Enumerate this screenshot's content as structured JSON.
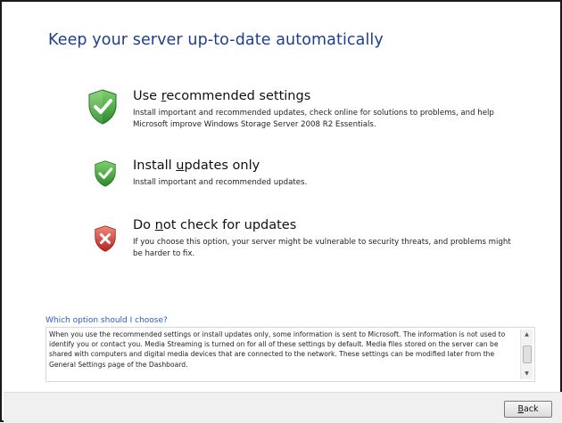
{
  "page": {
    "title": "Keep your server up-to-date automatically"
  },
  "options": [
    {
      "title_pre": "Use ",
      "title_acc": "r",
      "title_post": "ecommended settings",
      "description": "Install important and recommended updates, check online for solutions to problems, and help Microsoft improve Windows Storage Server 2008 R2 Essentials.",
      "icon": "shield-check-icon"
    },
    {
      "title_pre": "Install ",
      "title_acc": "u",
      "title_post": "pdates only",
      "description": "Install important and recommended updates.",
      "icon": "shield-check-icon"
    },
    {
      "title_pre": "Do ",
      "title_acc": "n",
      "title_post": "ot check for updates",
      "description": "If you choose this option, your server might be vulnerable to security threats, and problems might be harder to fix.",
      "icon": "shield-x-icon"
    }
  ],
  "help": {
    "link": "Which option should I choose?",
    "text": "When you use the recommended settings or install updates only, some information is sent to Microsoft. The information is not used to identify you or contact you. Media Streaming is turned on for all of these settings by default. Media files stored on the server can be shared with computers and digital media devices that are connected to the network. These settings can be modified later from the General Settings page of the Dashboard."
  },
  "footer": {
    "back_acc": "B",
    "back_post": "ack"
  },
  "colors": {
    "title": "#1d3f8f",
    "link": "#2a5bbf",
    "shield_green": "#3fa83a",
    "shield_red": "#c8312b"
  }
}
